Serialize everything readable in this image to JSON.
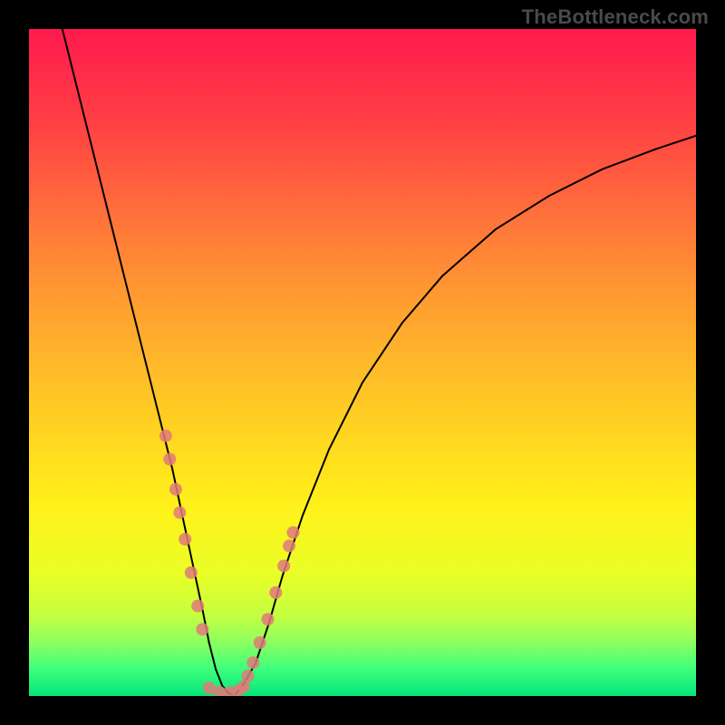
{
  "watermark": "TheBottleneck.com",
  "chart_data": {
    "type": "line",
    "title": "",
    "xlabel": "",
    "ylabel": "",
    "xlim": [
      0,
      100
    ],
    "ylim": [
      0,
      100
    ],
    "grid": false,
    "legend": false,
    "background_gradient": {
      "top": "#ff1a4d",
      "mid": "#fff21a",
      "bottom": "#06e57a"
    },
    "series": [
      {
        "name": "bottleneck-curve",
        "color": "#000000",
        "stroke_width": 2,
        "x": [
          5.0,
          6.5,
          8.0,
          9.5,
          11.0,
          12.5,
          14.0,
          15.5,
          17.0,
          18.5,
          20.0,
          21.5,
          23.0,
          24.5,
          26.0,
          27.0,
          28.0,
          29.0,
          30.0,
          31.0,
          32.0,
          34.0,
          36.0,
          38.0,
          41.0,
          45.0,
          50.0,
          56.0,
          62.0,
          70.0,
          78.0,
          86.0,
          94.0,
          100.0
        ],
        "y": [
          100.0,
          94.0,
          88.0,
          82.0,
          76.0,
          70.0,
          64.0,
          58.0,
          52.0,
          46.0,
          40.0,
          34.0,
          27.0,
          20.0,
          13.0,
          8.0,
          4.0,
          1.5,
          0.3,
          0.3,
          1.5,
          5.0,
          11.0,
          18.0,
          27.0,
          37.0,
          47.0,
          56.0,
          63.0,
          70.0,
          75.0,
          79.0,
          82.0,
          84.0
        ]
      }
    ],
    "marker_groups": [
      {
        "name": "left-branch-markers",
        "color": "#e07a7a",
        "radius": 7,
        "points": [
          {
            "x": 20.5,
            "y": 39.0
          },
          {
            "x": 21.1,
            "y": 35.5
          },
          {
            "x": 22.0,
            "y": 31.0
          },
          {
            "x": 22.6,
            "y": 27.5
          },
          {
            "x": 23.4,
            "y": 23.5
          },
          {
            "x": 24.3,
            "y": 18.5
          },
          {
            "x": 25.3,
            "y": 13.5
          },
          {
            "x": 26.0,
            "y": 10.0
          }
        ]
      },
      {
        "name": "right-branch-markers",
        "color": "#e07a7a",
        "radius": 7,
        "points": [
          {
            "x": 32.8,
            "y": 3.0
          },
          {
            "x": 33.6,
            "y": 5.0
          },
          {
            "x": 34.6,
            "y": 8.0
          },
          {
            "x": 35.8,
            "y": 11.5
          },
          {
            "x": 37.0,
            "y": 15.5
          },
          {
            "x": 38.2,
            "y": 19.5
          },
          {
            "x": 39.0,
            "y": 22.5
          },
          {
            "x": 39.6,
            "y": 24.5
          }
        ]
      },
      {
        "name": "trough-markers",
        "color": "#e07a7a",
        "radius": 7,
        "points": [
          {
            "x": 27.0,
            "y": 1.2
          },
          {
            "x": 28.5,
            "y": 0.6
          },
          {
            "x": 30.0,
            "y": 0.5
          },
          {
            "x": 31.3,
            "y": 0.8
          },
          {
            "x": 32.2,
            "y": 1.4
          }
        ]
      }
    ]
  }
}
